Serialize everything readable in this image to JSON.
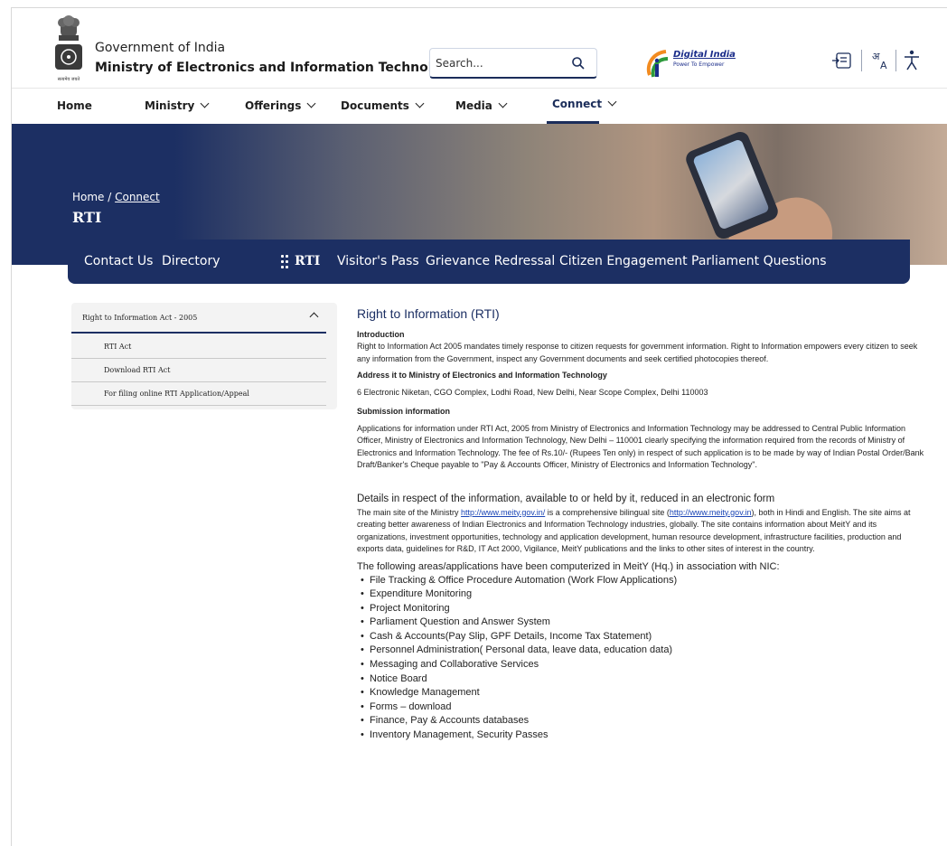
{
  "header": {
    "gov_line": "Government of India",
    "ministry_line": "Ministry of Electronics and Information Technology",
    "emblem_caption": "सत्यमेव जयते",
    "search_placeholder": "Search...",
    "digital_india_title": "Digital India",
    "digital_india_tagline": "Power To Empower",
    "icons": [
      "sitemap-icon",
      "language-icon",
      "accessibility-icon"
    ]
  },
  "nav": {
    "items": [
      {
        "label": "Home",
        "has_menu": false
      },
      {
        "label": "Ministry",
        "has_menu": true
      },
      {
        "label": "Offerings",
        "has_menu": true
      },
      {
        "label": "Documents",
        "has_menu": true
      },
      {
        "label": "Media",
        "has_menu": true
      },
      {
        "label": "Connect",
        "has_menu": true,
        "active": true
      }
    ]
  },
  "banner": {
    "crumb_home": "Home",
    "crumb_sep": " / ",
    "crumb_current": "Connect",
    "title": "RTI"
  },
  "subnav": {
    "items": [
      {
        "label": "Contact Us"
      },
      {
        "label": "Directory"
      },
      {
        "label": "RTI",
        "current": true
      },
      {
        "label": "Visitor's Pass"
      },
      {
        "label": "Grievance Redressal"
      },
      {
        "label": "Citizen Engagement"
      },
      {
        "label": "Parliament Questions"
      }
    ]
  },
  "sidebar": {
    "head": "Right to Information Act - 2005",
    "items": [
      {
        "label": "RTI Act"
      },
      {
        "label": "Download RTI Act"
      },
      {
        "label": "For filing online RTI Application/Appeal"
      }
    ]
  },
  "content": {
    "title": "Right to Information (RTI)",
    "intro_label": "Introduction",
    "intro_text": "Right to Information Act 2005 mandates timely response to citizen requests for government information. Right to Information empowers every citizen to seek any information from the Government, inspect any Government documents and seek certified photocopies thereof.",
    "address_label": "Address it to Ministry of Electronics and Information Technology",
    "address_text": "6 Electronic Niketan, CGO Complex, Lodhi Road, New Delhi, Near Scope Complex, Delhi 110003",
    "submission_label": "Submission information",
    "submission_text": "Applications for information under RTI Act, 2005 from Ministry of Electronics and Information Technology may be addressed to Central Public Information Officer, Ministry of Electronics and Information Technology, New Delhi – 110001 clearly specifying the information required from the records of Ministry of Electronics and Information Technology. The fee of Rs.10/- (Rupees Ten only) in respect of such application is to be made by way of Indian Postal Order/Bank Draft/Banker's Cheque payable to \"Pay & Accounts Officer, Ministry of Electronics and Information Technology\".",
    "details_heading": "Details in respect of the information, available to or held by it, reduced in an electronic form",
    "details_pre": "The main site of the Ministry ",
    "details_link1": "http://www.meity.gov.in/",
    "details_mid": " is a comprehensive bilingual site (",
    "details_link2": "http://www.meity.gov.in",
    "details_post": "), both in Hindi and English. The site aims at creating better awareness of Indian Electronics and Information Technology industries, globally. The site contains information about MeitY and its organizations, investment opportunities, technology and application development, human resource development, infrastructure facilities, production and exports data, guidelines for R&D, IT Act 2000, Vigilance, MeitY publications and the links to other sites of interest in the country.",
    "areas_heading": "The following areas/applications have been computerized in MeitY (Hq.) in association with NIC:",
    "areas": [
      "File Tracking & Office Procedure Automation (Work Flow Applications)",
      "Expenditure Monitoring",
      "Project Monitoring",
      "Parliament Question and Answer System",
      "Cash & Accounts(Pay Slip, GPF Details, Income Tax Statement)",
      "Personnel Administration( Personal data, leave data, education data)",
      "Messaging and Collaborative Services",
      "Notice Board",
      "Knowledge Management",
      "Forms – download",
      "Finance, Pay & Accounts databases",
      "Inventory Management, Security Passes"
    ]
  },
  "colors": {
    "brand_navy": "#1c2f63",
    "link": "#1b45b6"
  }
}
